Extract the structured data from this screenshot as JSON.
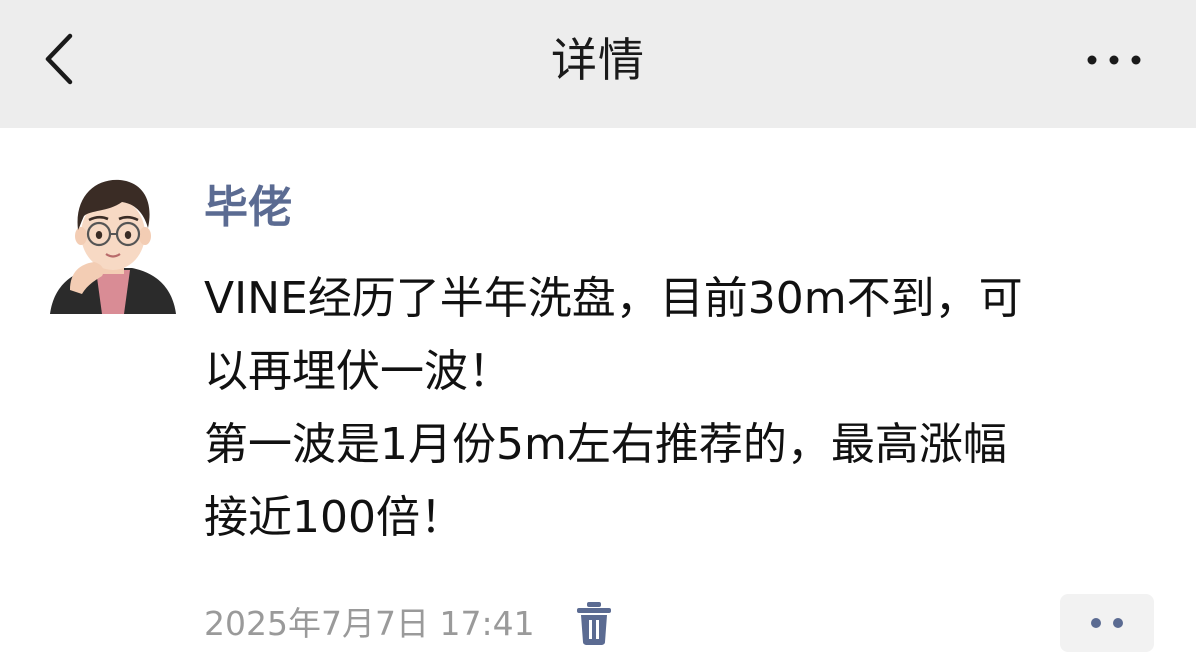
{
  "header": {
    "title": "详情",
    "back_icon": "chevron-left-icon",
    "more_icon": "ellipsis-horizontal-icon"
  },
  "post": {
    "author": "毕佬",
    "avatar_icon": "cartoon-avatar",
    "lines": [
      "VINE经历了半年洗盘，目前30m不到，可",
      "以再埋伏一波！",
      "第一波是1月份5m左右推荐的，最高涨幅",
      "接近100倍！"
    ],
    "timestamp": "2025年7月7日 17:41",
    "delete_icon": "trash-icon",
    "action_icon": "two-dots-icon"
  },
  "colors": {
    "header_bg": "#ededed",
    "author_name": "#5b6b92",
    "timestamp": "#9a9a9a",
    "icon_accent": "#5b6b92"
  }
}
